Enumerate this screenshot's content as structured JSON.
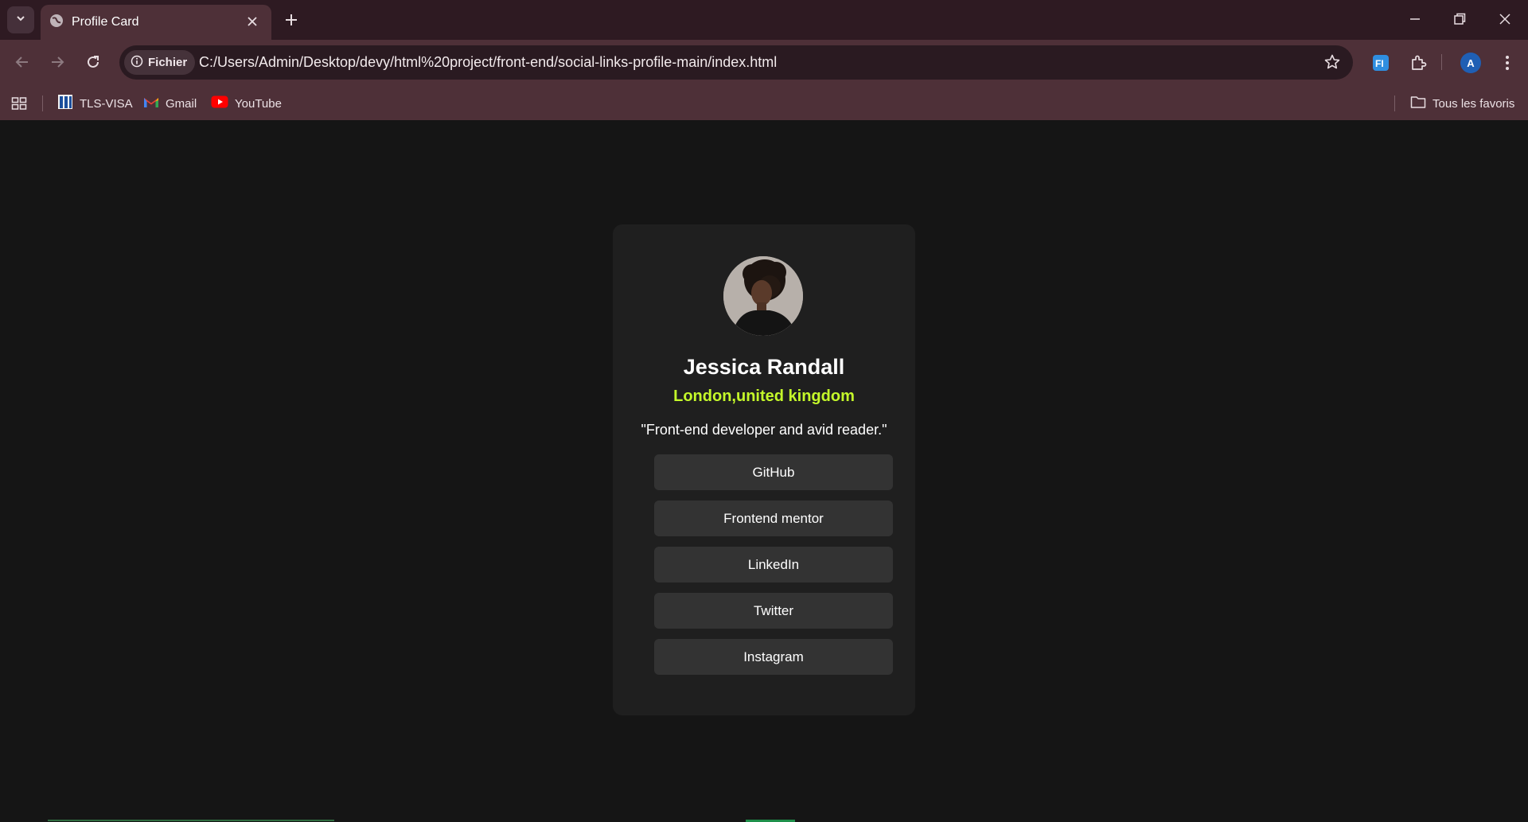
{
  "browser": {
    "tab": {
      "title": "Profile Card"
    },
    "omnibox": {
      "chip_label": "Fichier",
      "url": "C:/Users/Admin/Desktop/devy/html%20project/front-end/social-links-profile-main/index.html"
    },
    "profile_initial": "A",
    "bookmarks": [
      {
        "label": "TLS-VISA"
      },
      {
        "label": "Gmail"
      },
      {
        "label": "YouTube"
      }
    ],
    "all_bookmarks_label": "Tous les favoris"
  },
  "profile": {
    "name": "Jessica Randall",
    "location": "London,united kingdom",
    "bio": "\"Front-end developer and avid reader.\"",
    "links": [
      {
        "label": "GitHub"
      },
      {
        "label": "Frontend mentor"
      },
      {
        "label": "LinkedIn"
      },
      {
        "label": "Twitter"
      },
      {
        "label": "Instagram"
      }
    ]
  },
  "colors": {
    "page_background": "#151515",
    "card_background": "#1f1f1f",
    "button_background": "#333333",
    "accent_location": "#c4f82a",
    "browser_frame": "#4e3038"
  }
}
